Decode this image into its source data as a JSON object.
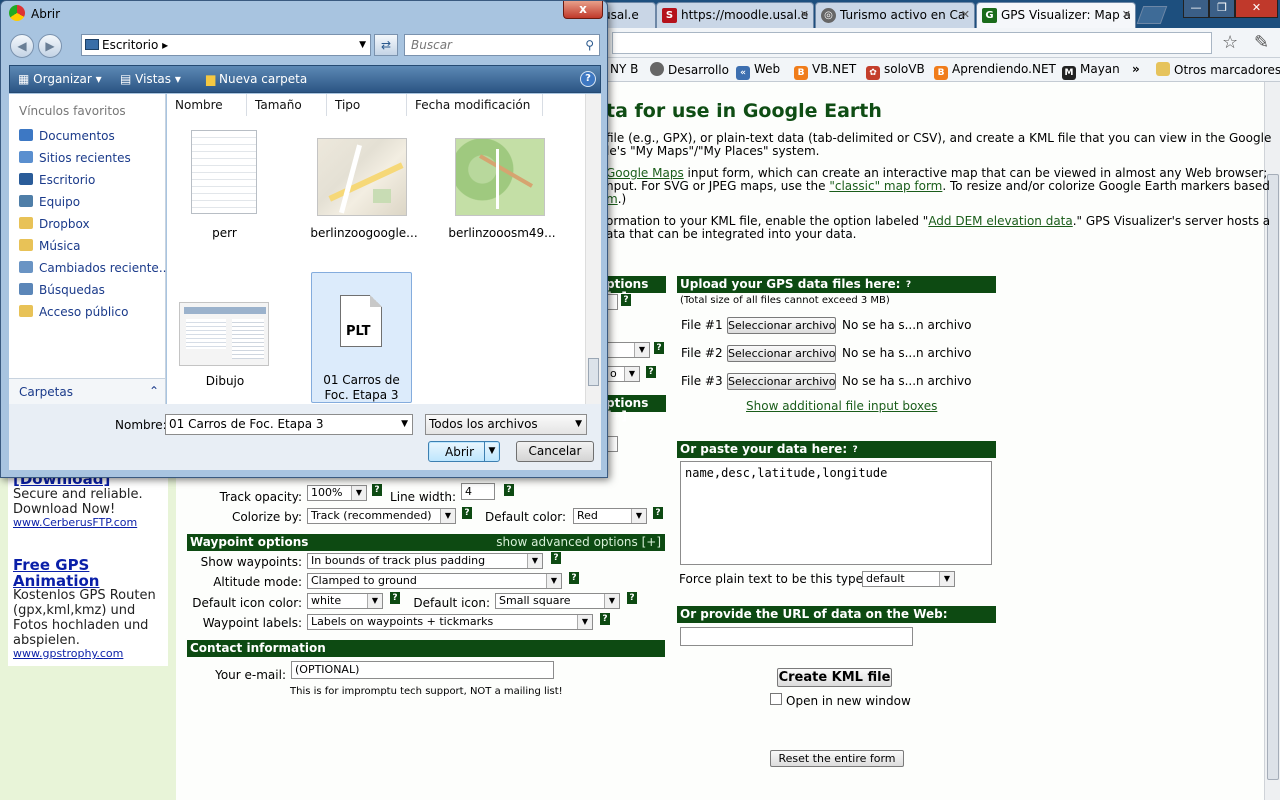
{
  "browser": {
    "tabs": [
      {
        "label": "usal.e",
        "icon": "google-icon"
      },
      {
        "label": "https://moodle.usal.e",
        "icon": "moodle-icon"
      },
      {
        "label": "Turismo activo en Ca",
        "icon": "globe-icon"
      },
      {
        "label": "GPS Visualizer: Map a",
        "icon": "gpsvisualizer-icon"
      }
    ],
    "bookmarks": [
      "NY B",
      "Desarrollo",
      "Web",
      "VB.NET",
      "soloVB",
      "Aprendiendo.NET",
      "Mayan",
      "»",
      "Otros marcadores"
    ]
  },
  "page": {
    "title": "ta for use in Google Earth",
    "intro_lines": [
      "file (e.g., GPX), or plain-text data (tab-delimited or CSV), and create a KML file that you can view in the Google",
      "le's \"My Maps\"/\"My Places\" system."
    ],
    "gmaps_line1_link": "Google Maps",
    "gmaps_line1_rest": " input form, which can create an interactive map that can be viewed in almost any Web browser;",
    "gmaps_line2_pre": "nput. For SVG or JPEG maps, use the ",
    "gmaps_line2_link": "\"classic\" map form",
    "gmaps_line2_post": ". To resize and/or colorize Google Earth markers based",
    "gmaps_line3_link": "m",
    "gmaps_line3_post": ".)",
    "dem_pre": "ormation to your KML file, enable the option labeled \"",
    "dem_link": "Add DEM elevation data",
    "dem_post": ".\" GPS Visualizer's server hosts a",
    "dem_line2": "ata that can be integrated into your data.",
    "upload": {
      "header": "Upload your GPS data files here:",
      "note": "(Total size of all files cannot exceed 3 MB)",
      "files": [
        {
          "label": "File #1",
          "button": "Seleccionar archivo",
          "status": "No se ha s...n archivo"
        },
        {
          "label": "File #2",
          "button": "Seleccionar archivo",
          "status": "No se ha s...n archivo"
        },
        {
          "label": "File #3",
          "button": "Seleccionar archivo",
          "status": "No se ha s...n archivo"
        }
      ],
      "more_link": "Show additional file input boxes"
    },
    "paste": {
      "header": "Or paste your data here:",
      "value": "name,desc,latitude,longitude",
      "force_label": "Force plain text to be this type:",
      "force_value": "default"
    },
    "url": {
      "header": "Or provide the URL of data on the Web:",
      "value": ""
    },
    "create_button": "Create KML file",
    "new_window_label": "Open in new window",
    "reset_button": "Reset the entire form",
    "partial_headers": [
      "ptions [+]",
      "ptions [+]"
    ],
    "partial_select_value": "o",
    "track": {
      "opacity_label": "Track opacity:",
      "opacity_value": "100%",
      "width_label": "Line width:",
      "width_value": "4",
      "colorize_label": "Colorize by:",
      "colorize_value": "Track (recommended)",
      "color_label": "Default color:",
      "color_value": "Red"
    },
    "waypoint": {
      "header": "Waypoint options",
      "advanced": "show advanced options [+]",
      "show_label": "Show waypoints:",
      "show_value": "In bounds of track plus padding",
      "alt_label": "Altitude mode:",
      "alt_value": "Clamped to ground",
      "iconcolor_label": "Default icon color:",
      "iconcolor_value": "white",
      "icon_label": "Default icon:",
      "icon_value": "Small square",
      "labels_label": "Waypoint labels:",
      "labels_value": "Labels on waypoints + tickmarks"
    },
    "contact": {
      "header": "Contact information",
      "email_label": "Your e-mail:",
      "email_value": "(OPTIONAL)",
      "note": "This is for impromptu tech support, NOT a mailing list!"
    },
    "ads": [
      {
        "title": "[Download]",
        "text": "Secure and reliable. Download Now!",
        "url": "www.CerberusFTP.com"
      },
      {
        "title": "Free GPS Animation",
        "text": "Kostenlos GPS Routen (gpx,kml,kmz) und Fotos hochladen und abspielen.",
        "url": "www.gpstrophy.com"
      }
    ]
  },
  "dialog": {
    "title": "Abrir",
    "close": "x",
    "location": "Escritorio",
    "search_placeholder": "Buscar",
    "toolbar": {
      "organize": "Organizar",
      "views": "Vistas",
      "new_folder": "Nueva carpeta"
    },
    "favorites_title": "Vínculos favoritos",
    "favorites": [
      "Documentos",
      "Sitios recientes",
      "Escritorio",
      "Equipo",
      "Dropbox",
      "Música",
      "Cambiados reciente...",
      "Búsquedas",
      "Acceso público"
    ],
    "folders_label": "Carpetas",
    "columns": [
      "Nombre",
      "Tamaño",
      "Tipo",
      "Fecha modificación"
    ],
    "files": [
      {
        "name": "perr",
        "kind": "text"
      },
      {
        "name": "berlinzoogoogle...",
        "kind": "map"
      },
      {
        "name": "berlinzooosm49...",
        "kind": "osm"
      },
      {
        "name": "Dibujo",
        "kind": "screenshot"
      },
      {
        "name": "01 Carros de Foc. Etapa 3",
        "kind": "plt",
        "badge": "PLT"
      }
    ],
    "name_label": "Nombre:",
    "name_value": "01 Carros de Foc. Etapa 3",
    "filter_value": "Todos los archivos",
    "open_button": "Abrir",
    "cancel_button": "Cancelar"
  }
}
